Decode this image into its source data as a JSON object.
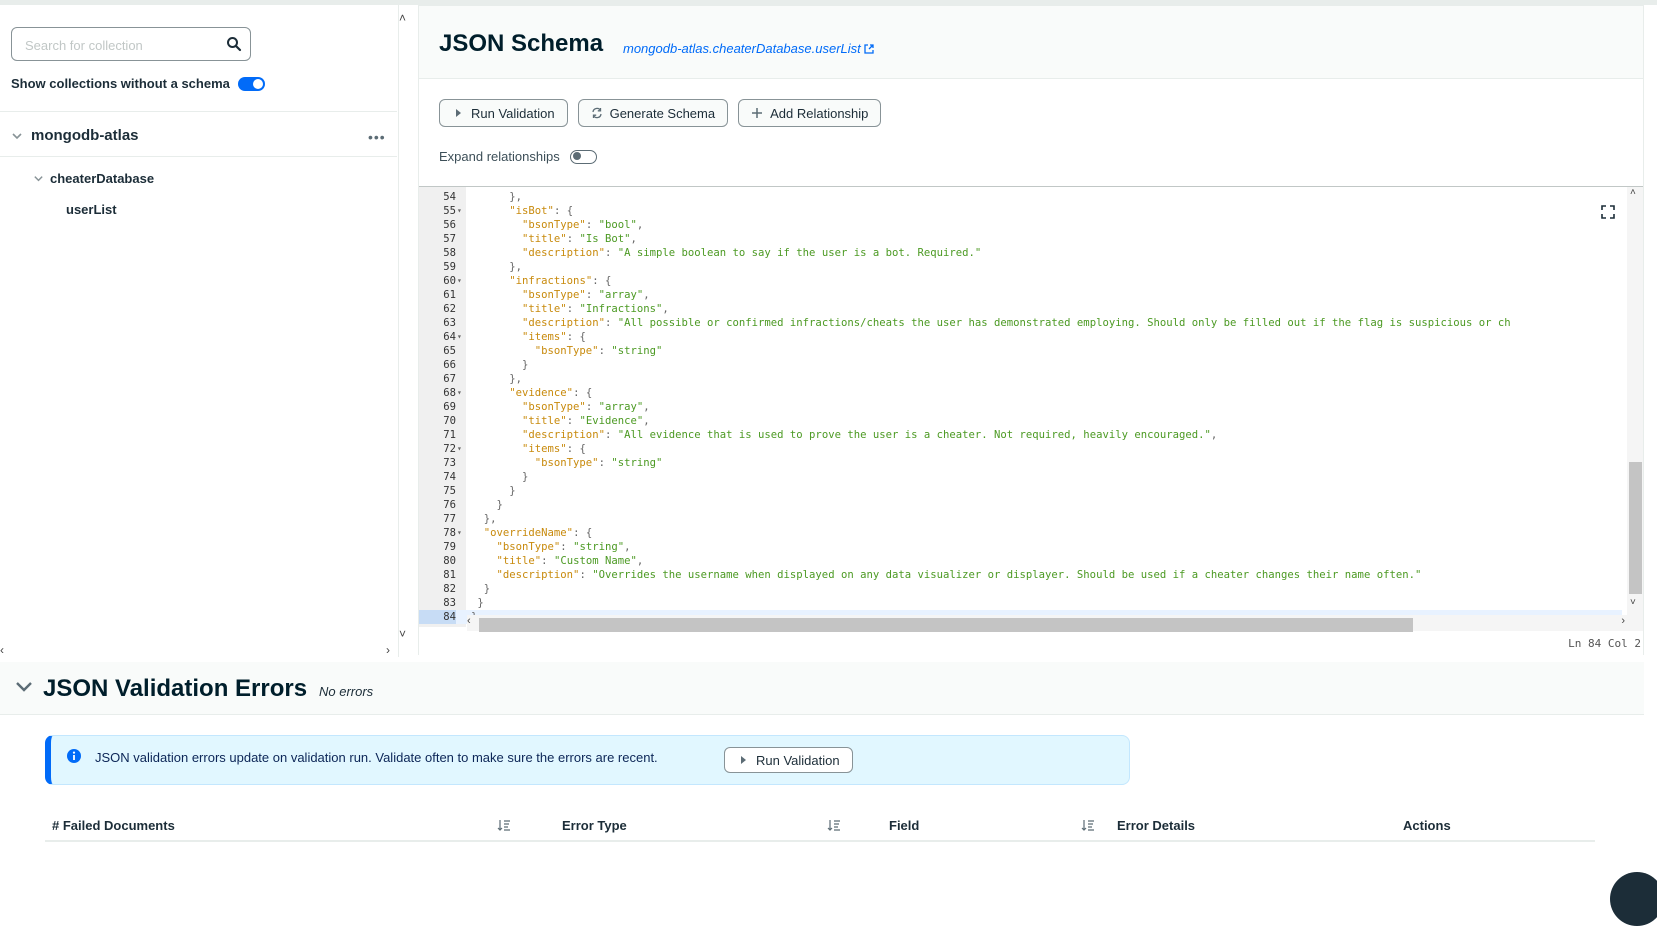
{
  "sidebar": {
    "search_placeholder": "Search for collection",
    "show_without_schema_label": "Show collections without a schema",
    "show_without_schema_on": true,
    "database": "mongodb-atlas",
    "more_glyph": "•••",
    "sub_database": "cheaterDatabase",
    "collection": "userList"
  },
  "main": {
    "title": "JSON Schema",
    "collection_link": "mongodb-atlas.cheaterDatabase.userList",
    "buttons": {
      "run_validation": "Run Validation",
      "generate_schema": "Generate Schema",
      "add_relationship": "Add Relationship"
    },
    "expand_relationships_label": "Expand relationships",
    "expand_relationships_on": false
  },
  "editor": {
    "status": "Ln 84 Col 2",
    "active_line": 84,
    "lines": [
      {
        "n": 54,
        "fold": false,
        "indent": 6,
        "tokens": [
          [
            "p",
            "},"
          ]
        ]
      },
      {
        "n": 55,
        "fold": true,
        "indent": 6,
        "tokens": [
          [
            "k",
            "\"isBot\""
          ],
          [
            "p",
            ": {"
          ]
        ]
      },
      {
        "n": 56,
        "fold": false,
        "indent": 8,
        "tokens": [
          [
            "k",
            "\"bsonType\""
          ],
          [
            "p",
            ": "
          ],
          [
            "s",
            "\"bool\""
          ],
          [
            "p",
            ","
          ]
        ]
      },
      {
        "n": 57,
        "fold": false,
        "indent": 8,
        "tokens": [
          [
            "k",
            "\"title\""
          ],
          [
            "p",
            ": "
          ],
          [
            "s",
            "\"Is Bot\""
          ],
          [
            "p",
            ","
          ]
        ]
      },
      {
        "n": 58,
        "fold": false,
        "indent": 8,
        "tokens": [
          [
            "k",
            "\"description\""
          ],
          [
            "p",
            ": "
          ],
          [
            "s",
            "\"A simple boolean to say if the user is a bot. Required.\""
          ]
        ]
      },
      {
        "n": 59,
        "fold": false,
        "indent": 6,
        "tokens": [
          [
            "p",
            "},"
          ]
        ]
      },
      {
        "n": 60,
        "fold": true,
        "indent": 6,
        "tokens": [
          [
            "k",
            "\"infractions\""
          ],
          [
            "p",
            ": {"
          ]
        ]
      },
      {
        "n": 61,
        "fold": false,
        "indent": 8,
        "tokens": [
          [
            "k",
            "\"bsonType\""
          ],
          [
            "p",
            ": "
          ],
          [
            "s",
            "\"array\""
          ],
          [
            "p",
            ","
          ]
        ]
      },
      {
        "n": 62,
        "fold": false,
        "indent": 8,
        "tokens": [
          [
            "k",
            "\"title\""
          ],
          [
            "p",
            ": "
          ],
          [
            "s",
            "\"Infractions\""
          ],
          [
            "p",
            ","
          ]
        ]
      },
      {
        "n": 63,
        "fold": false,
        "indent": 8,
        "tokens": [
          [
            "k",
            "\"description\""
          ],
          [
            "p",
            ": "
          ],
          [
            "s",
            "\"All possible or confirmed infractions/cheats the user has demonstrated employing. Should only be filled out if the flag is suspicious or ch"
          ]
        ]
      },
      {
        "n": 64,
        "fold": true,
        "indent": 8,
        "tokens": [
          [
            "k",
            "\"items\""
          ],
          [
            "p",
            ": {"
          ]
        ]
      },
      {
        "n": 65,
        "fold": false,
        "indent": 10,
        "tokens": [
          [
            "k",
            "\"bsonType\""
          ],
          [
            "p",
            ": "
          ],
          [
            "s",
            "\"string\""
          ]
        ]
      },
      {
        "n": 66,
        "fold": false,
        "indent": 8,
        "tokens": [
          [
            "p",
            "}"
          ]
        ]
      },
      {
        "n": 67,
        "fold": false,
        "indent": 6,
        "tokens": [
          [
            "p",
            "},"
          ]
        ]
      },
      {
        "n": 68,
        "fold": true,
        "indent": 6,
        "tokens": [
          [
            "k",
            "\"evidence\""
          ],
          [
            "p",
            ": {"
          ]
        ]
      },
      {
        "n": 69,
        "fold": false,
        "indent": 8,
        "tokens": [
          [
            "k",
            "\"bsonType\""
          ],
          [
            "p",
            ": "
          ],
          [
            "s",
            "\"array\""
          ],
          [
            "p",
            ","
          ]
        ]
      },
      {
        "n": 70,
        "fold": false,
        "indent": 8,
        "tokens": [
          [
            "k",
            "\"title\""
          ],
          [
            "p",
            ": "
          ],
          [
            "s",
            "\"Evidence\""
          ],
          [
            "p",
            ","
          ]
        ]
      },
      {
        "n": 71,
        "fold": false,
        "indent": 8,
        "tokens": [
          [
            "k",
            "\"description\""
          ],
          [
            "p",
            ": "
          ],
          [
            "s",
            "\"All evidence that is used to prove the user is a cheater. Not required, heavily encouraged.\""
          ],
          [
            "p",
            ","
          ]
        ]
      },
      {
        "n": 72,
        "fold": true,
        "indent": 8,
        "tokens": [
          [
            "k",
            "\"items\""
          ],
          [
            "p",
            ": {"
          ]
        ]
      },
      {
        "n": 73,
        "fold": false,
        "indent": 10,
        "tokens": [
          [
            "k",
            "\"bsonType\""
          ],
          [
            "p",
            ": "
          ],
          [
            "s",
            "\"string\""
          ]
        ]
      },
      {
        "n": 74,
        "fold": false,
        "indent": 8,
        "tokens": [
          [
            "p",
            "}"
          ]
        ]
      },
      {
        "n": 75,
        "fold": false,
        "indent": 6,
        "tokens": [
          [
            "p",
            "}"
          ]
        ]
      },
      {
        "n": 76,
        "fold": false,
        "indent": 4,
        "tokens": [
          [
            "p",
            "}"
          ]
        ]
      },
      {
        "n": 77,
        "fold": false,
        "indent": 2,
        "tokens": [
          [
            "p",
            "},"
          ]
        ]
      },
      {
        "n": 78,
        "fold": true,
        "indent": 2,
        "tokens": [
          [
            "k",
            "\"overrideName\""
          ],
          [
            "p",
            ": {"
          ]
        ]
      },
      {
        "n": 79,
        "fold": false,
        "indent": 4,
        "tokens": [
          [
            "k",
            "\"bsonType\""
          ],
          [
            "p",
            ": "
          ],
          [
            "s",
            "\"string\""
          ],
          [
            "p",
            ","
          ]
        ]
      },
      {
        "n": 80,
        "fold": false,
        "indent": 4,
        "tokens": [
          [
            "k",
            "\"title\""
          ],
          [
            "p",
            ": "
          ],
          [
            "s",
            "\"Custom Name\""
          ],
          [
            "p",
            ","
          ]
        ]
      },
      {
        "n": 81,
        "fold": false,
        "indent": 4,
        "tokens": [
          [
            "k",
            "\"description\""
          ],
          [
            "p",
            ": "
          ],
          [
            "s",
            "\"Overrides the username when displayed on any data visualizer or displayer. Should be used if a cheater changes their name often.\""
          ]
        ]
      },
      {
        "n": 82,
        "fold": false,
        "indent": 2,
        "tokens": [
          [
            "p",
            "}"
          ]
        ]
      },
      {
        "n": 83,
        "fold": false,
        "indent": 1,
        "tokens": [
          [
            "p",
            "}"
          ]
        ]
      },
      {
        "n": 84,
        "fold": false,
        "indent": 0,
        "tokens": [
          [
            "p",
            "}"
          ]
        ]
      }
    ]
  },
  "errors": {
    "title": "JSON Validation Errors",
    "subtitle": "No errors",
    "callout_message": "JSON validation errors update on validation run. Validate often to make sure the errors are recent.",
    "callout_button": "Run Validation",
    "columns": [
      "# Failed Documents",
      "Error Type",
      "Field",
      "Error Details",
      "Actions"
    ]
  },
  "colors": {
    "accent": "#016bf8",
    "key": "#c88a0c",
    "string": "#4c9a23",
    "callout_bg": "#e1f7ff"
  }
}
